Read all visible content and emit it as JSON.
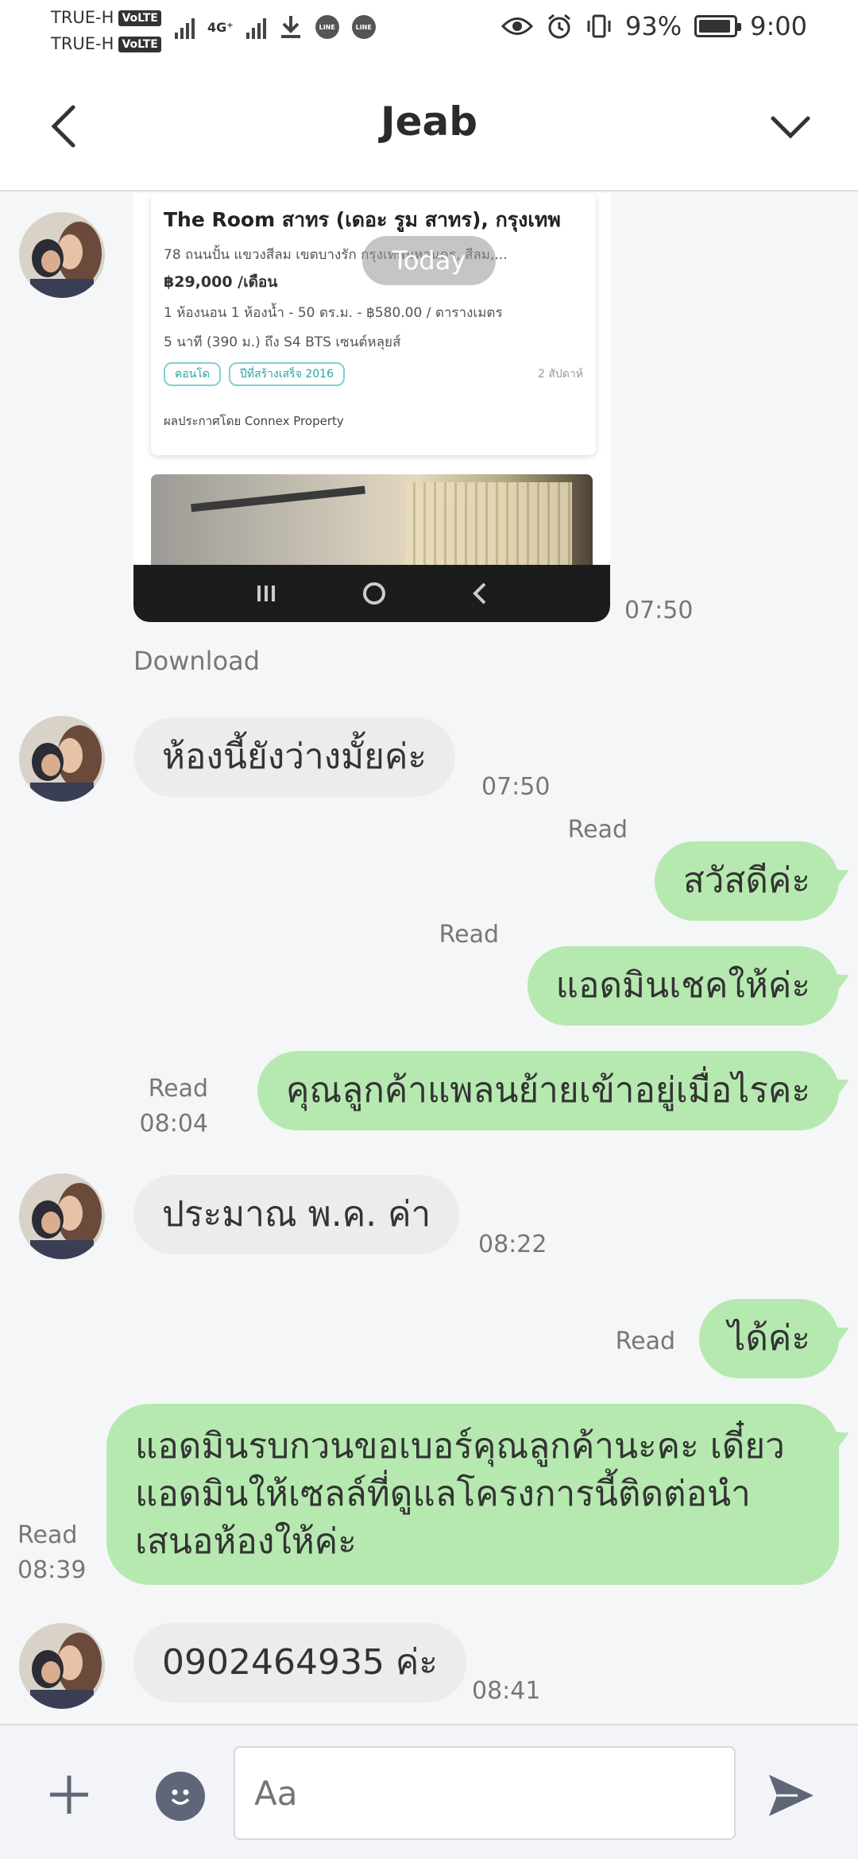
{
  "status_bar": {
    "carrier_1": "TRUE-H",
    "carrier_2": "TRUE-H",
    "volte_label": "VoLTE",
    "network_label": "4G⁺",
    "line_badge": "LINE",
    "battery_percent": "93%",
    "battery_level": 0.93,
    "time": "9:00",
    "icons": [
      "signal-icon",
      "download-icon",
      "line-icon",
      "line-icon",
      "eye-icon",
      "alarm-icon",
      "vibrate-icon",
      "battery-icon"
    ]
  },
  "header": {
    "title": "Jeab",
    "back_icon": "chevron-left-icon",
    "menu_icon": "chevron-down-icon"
  },
  "shared_card": {
    "title": "The Room สาทร (เดอะ รูม สาทร), กรุงเทพ",
    "address": "78 ถนนปั้น แขวงสีลม เขตบางรัก กรุงเทพมหานคร, สีลม,...",
    "price": "฿29,000 /เดือน",
    "specs": "1 ห้องนอน  1 ห้องน้ำ  -  50 ตร.ม.  -  ฿580.00 / ตารางเมตร",
    "transit": "5 นาที (390 ม.) ถึง S4 BTS เซนต์หลุยส์",
    "tags": [
      "คอนโด",
      "ปีที่สร้างเสร็จ 2016"
    ],
    "posted": "2 สัปดาห์",
    "source": "ผลประกาศโดย Connex Property",
    "time": "07:50"
  },
  "date_divider": "Today",
  "download_label": "Download",
  "messages": [
    {
      "dir": "in",
      "text": "ห้องนี้ยังว่างมั้ยค่ะ",
      "time": "07:50"
    },
    {
      "dir": "out",
      "text": "สวัสดีค่ะ",
      "read": "Read",
      "time": ""
    },
    {
      "dir": "out",
      "text": "แอดมินเชคให้ค่ะ",
      "read": "Read",
      "time": ""
    },
    {
      "dir": "out",
      "text": "คุณลูกค้าแพลนย้ายเข้าอยู่เมื่อไรคะ",
      "read": "Read",
      "time": "08:04"
    },
    {
      "dir": "in",
      "text": "ประมาณ พ.ค. ค่า",
      "time": "08:22"
    },
    {
      "dir": "out",
      "text": "ได้ค่ะ",
      "read": "Read",
      "time": ""
    },
    {
      "dir": "out",
      "lines": [
        "แอดมินรบกวนขอเบอร์คุณลูกค้านะคะ เดี๋ยว",
        "แอดมินให้เซลล์ที่ดูแลโครงการนี้ติดต่อนำ",
        "เสนอห้องให้ค่ะ"
      ],
      "read": "Read",
      "time": "08:39"
    },
    {
      "dir": "in",
      "text": "0902464935 ค่ะ",
      "time": "08:41"
    }
  ],
  "composer": {
    "placeholder": "Aa",
    "plus_icon": "plus-icon",
    "emoji_icon": "emoji-icon",
    "send_icon": "send-icon"
  },
  "colors": {
    "outgoing_bubble": "#b6e9b0",
    "incoming_bubble": "#ececef",
    "background": "#f5f6f8"
  }
}
